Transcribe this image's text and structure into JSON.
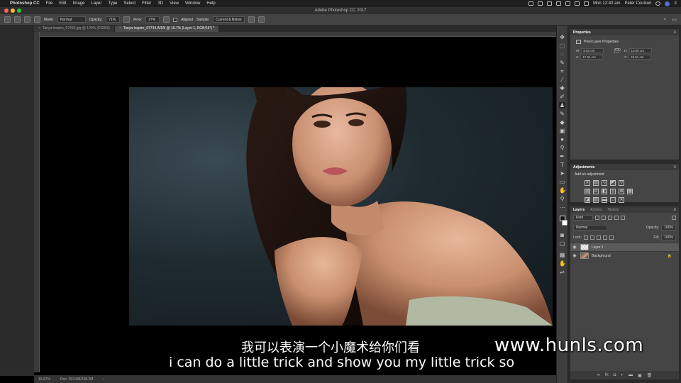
{
  "menubar": {
    "app_name": "Photoshop CC",
    "items": [
      "File",
      "Edit",
      "Image",
      "Layer",
      "Type",
      "Select",
      "Filter",
      "3D",
      "View",
      "Window",
      "Help"
    ],
    "clock": "Mon 12:40 am",
    "user": "Peter Coulson"
  },
  "window": {
    "title": "Adobe Photoshop CC 2017",
    "traffic_colors": [
      "#ff5f57",
      "#febc2e",
      "#28c840"
    ]
  },
  "options": {
    "mode_label": "Mode:",
    "mode_value": "Normal",
    "opacity_label": "Opacity:",
    "opacity_value": "71%",
    "flow_label": "Flow:",
    "flow_value": "27%",
    "aligned_label": "Aligned",
    "sample_label": "Sample:",
    "sample_value": "Current & Below"
  },
  "doc_tabs": [
    {
      "label": "Tanya-inspire_07459.jpg @ 100% (RGB/8)",
      "active": false
    },
    {
      "label": "Tanya-inspire_07734.ARW @ 16.7% (Layer 1, RGB/16*) *",
      "active": true
    }
  ],
  "status": {
    "zoom": "16.67%",
    "doc_size": "Doc: 263.0M/228.2M"
  },
  "tools": [
    "move",
    "marquee",
    "lasso",
    "quick-select",
    "crop",
    "eyedropper",
    "healing",
    "brush",
    "clone-stamp",
    "history-brush",
    "eraser",
    "gradient",
    "blur",
    "dodge",
    "pen",
    "type",
    "path-select",
    "shape",
    "hand",
    "zoom",
    "more"
  ],
  "properties": {
    "tab": "Properties",
    "title": "Pixel Layer Properties",
    "w_label": "W:",
    "w_value": "8.63 cm",
    "h_label": "H:",
    "h_value": "10.00 cm",
    "x_label": "X:",
    "x_value": "17.91 cm",
    "y_label": "Y:",
    "y_value": "18.61 cm",
    "link_label": "GO"
  },
  "adjustments": {
    "tab": "Adjustments",
    "subtitle": "Add an adjustment"
  },
  "layers": {
    "tabs": [
      "Layers",
      "Actions",
      "History"
    ],
    "kind_value": "Kind",
    "blend_value": "Normal",
    "opacity_label": "Opacity:",
    "opacity_value": "100%",
    "lock_label": "Lock:",
    "fill_label": "Fill:",
    "fill_value": "100%",
    "rows": [
      {
        "name": "Layer 1",
        "selected": true
      },
      {
        "name": "Background",
        "selected": false
      }
    ]
  },
  "subtitles": {
    "chinese": "我可以表演一个小魔术给你们看",
    "english": "i can do a little trick and show you my little trick so"
  },
  "watermark": "www.hunls.com"
}
